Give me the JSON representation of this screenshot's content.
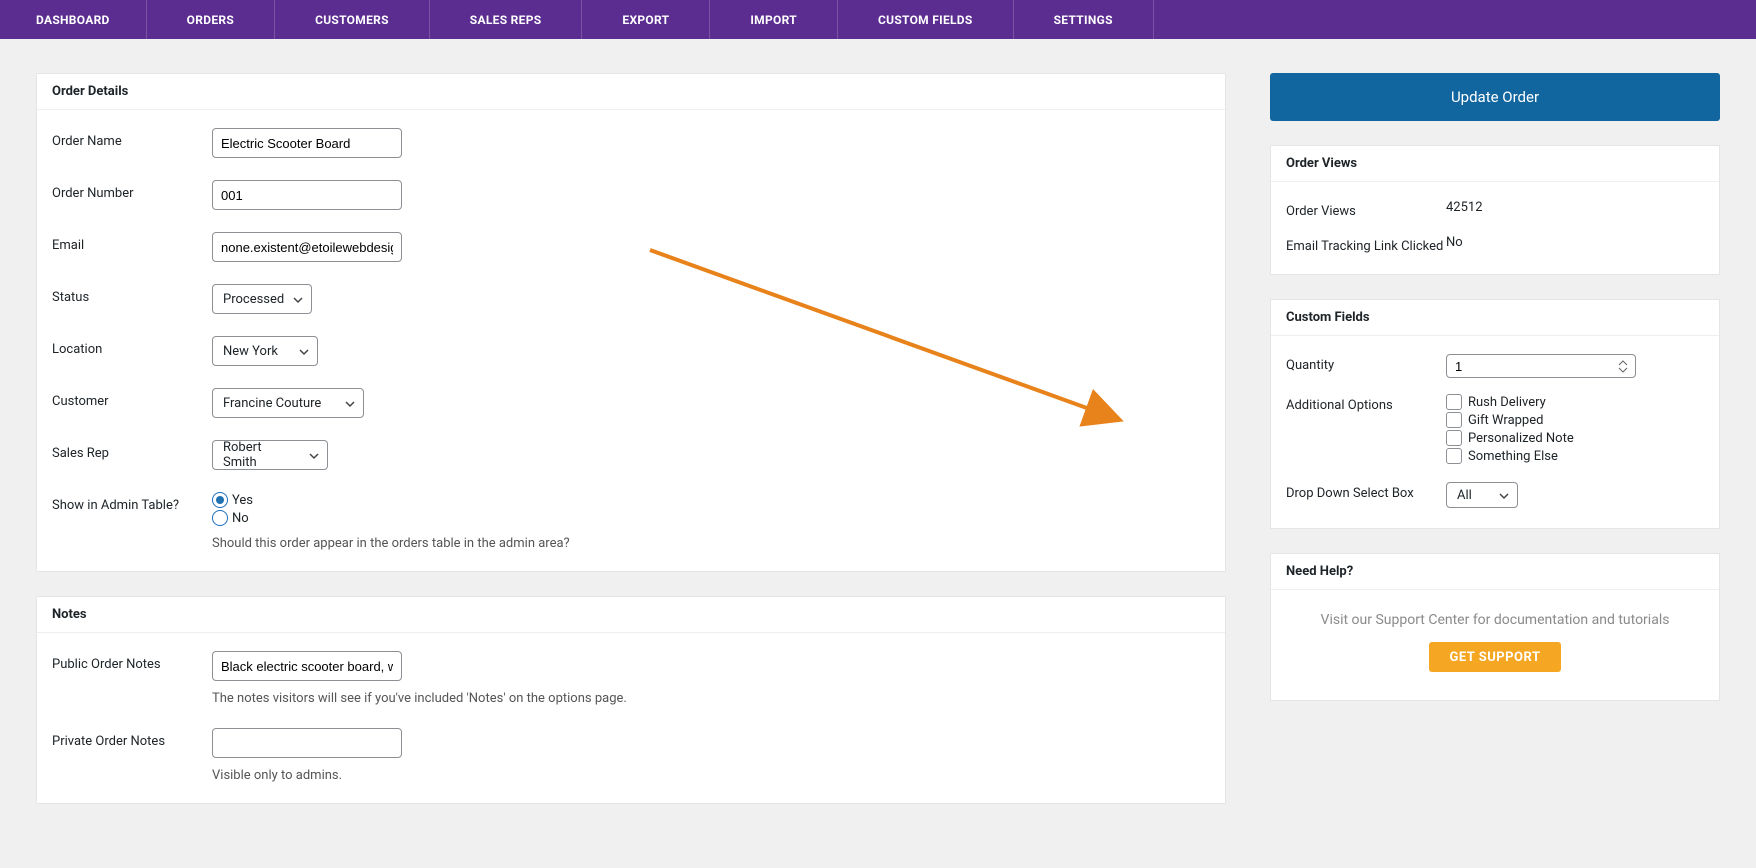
{
  "nav": [
    "DASHBOARD",
    "ORDERS",
    "CUSTOMERS",
    "SALES REPS",
    "EXPORT",
    "IMPORT",
    "CUSTOM FIELDS",
    "SETTINGS"
  ],
  "orderDetails": {
    "header": "Order Details",
    "labels": {
      "orderName": "Order Name",
      "orderNumber": "Order Number",
      "email": "Email",
      "status": "Status",
      "location": "Location",
      "customer": "Customer",
      "salesRep": "Sales Rep",
      "showAdmin": "Show in Admin Table?"
    },
    "values": {
      "orderName": "Electric Scooter Board",
      "orderNumber": "001",
      "email": "none.existent@etoilewebdesig",
      "status": "Processed",
      "location": "New York",
      "customer": "Francine Couture",
      "salesRep": "Robert Smith"
    },
    "radios": {
      "yes": "Yes",
      "no": "No"
    },
    "helper": "Should this order appear in the orders table in the admin area?"
  },
  "notes": {
    "header": "Notes",
    "labels": {
      "public": "Public Order Notes",
      "private": "Private Order Notes"
    },
    "values": {
      "public": "Black electric scooter board, w",
      "private": ""
    },
    "helpers": {
      "public": "The notes visitors will see if you've included 'Notes' on the options page.",
      "private": "Visible only to admins."
    }
  },
  "updateBtn": "Update Order",
  "orderViews": {
    "header": "Order Views",
    "labels": {
      "views": "Order Views",
      "tracking": "Email Tracking Link Clicked"
    },
    "values": {
      "views": "42512",
      "tracking": "No"
    }
  },
  "customFields": {
    "header": "Custom Fields",
    "labels": {
      "quantity": "Quantity",
      "options": "Additional Options",
      "dropdown": "Drop Down Select Box"
    },
    "quantity": "1",
    "checkboxes": [
      "Rush Delivery",
      "Gift Wrapped",
      "Personalized Note",
      "Something Else"
    ],
    "dropdown": "All"
  },
  "help": {
    "header": "Need Help?",
    "text": "Visit our Support Center for documentation and tutorials",
    "button": "GET SUPPORT"
  }
}
